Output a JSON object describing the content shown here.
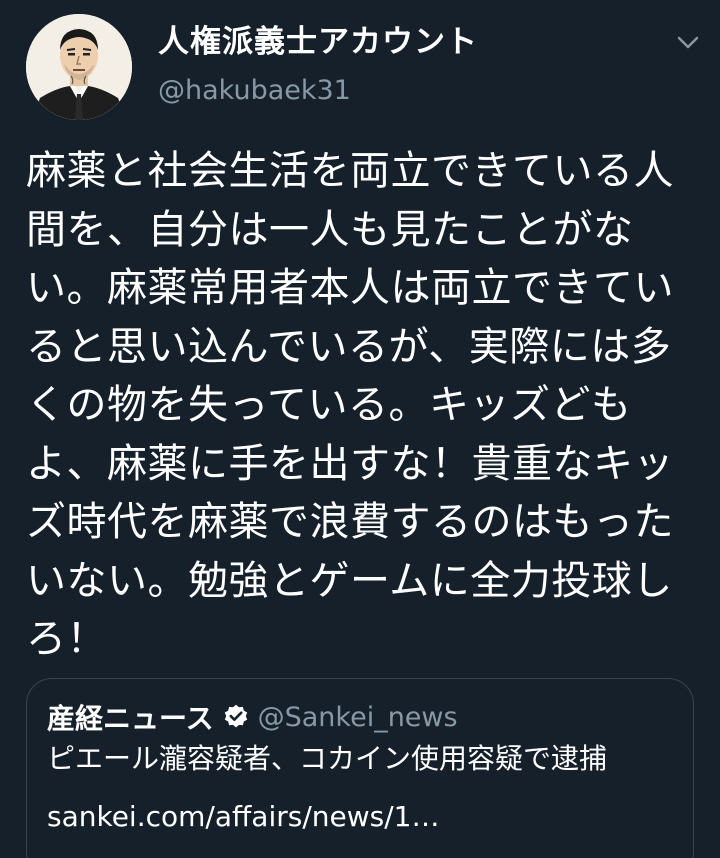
{
  "author": {
    "display_name": "人権派義士アカウント",
    "handle": "@hakubaek31",
    "avatar_icon": "avatar-portrait-icon"
  },
  "menu_icon": "chevron-down-icon",
  "tweet": {
    "text": "麻薬と社会生活を両立できている人間を、自分は一人も見たことがない。麻薬常用者本人は両立できていると思い込んでいるが、実際には多くの物を失っている。キッズどもよ、麻薬に手を出すな！貴重なキッズ時代を麻薬で浪費するのはもったいない。勉強とゲームに全力投球しろ！"
  },
  "quoted_tweet": {
    "display_name": "産経ニュース",
    "verified_icon": "verified-badge-icon",
    "handle": "@Sankei_news",
    "text": "ピエール瀧容疑者、コカイン使用容疑で逮捕",
    "link": "sankei.com/affairs/news/1…"
  },
  "colors": {
    "background": "#15202b",
    "text": "#ffffff",
    "secondary_text": "#8899a6",
    "card_border": "#38444d"
  }
}
